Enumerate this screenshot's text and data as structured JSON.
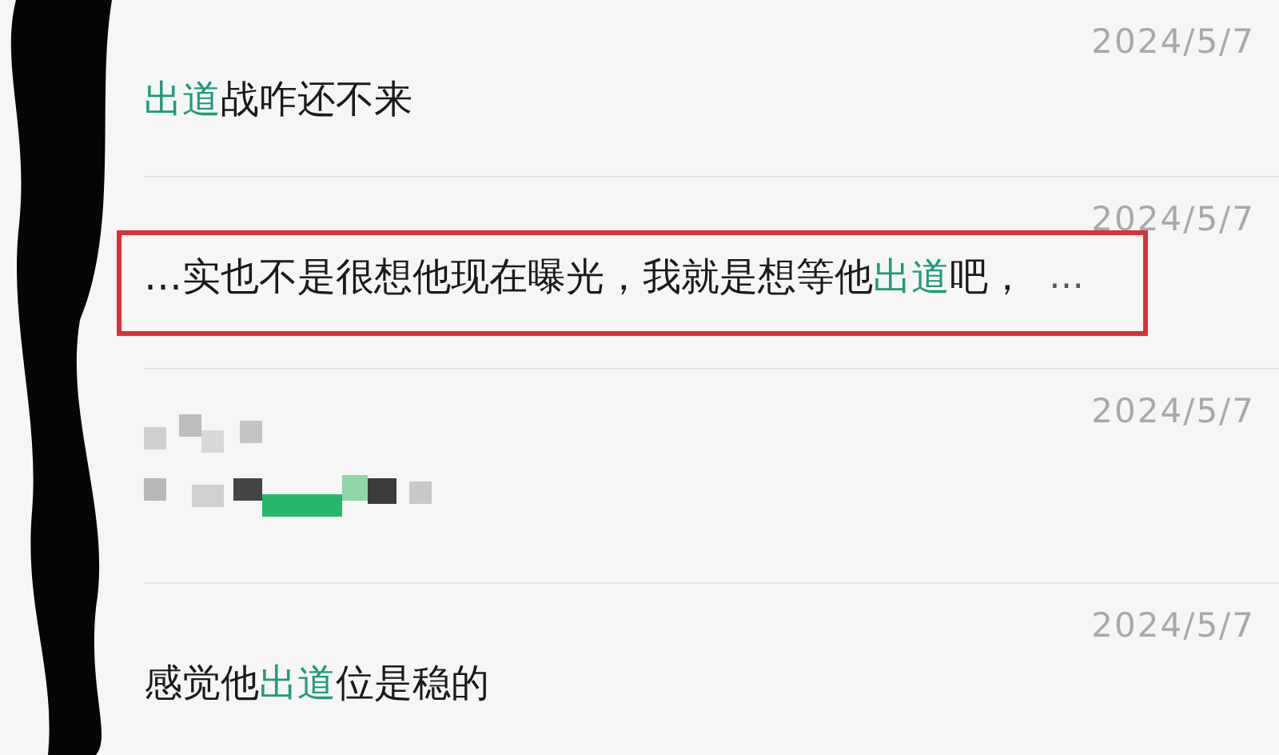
{
  "results": [
    {
      "kind": "text",
      "date": "2024/5/7",
      "boxed": false,
      "segments": [
        {
          "text": "出道",
          "highlight": true
        },
        {
          "text": "战咋还不来",
          "highlight": false
        }
      ]
    },
    {
      "kind": "text",
      "date": "2024/5/7",
      "boxed": true,
      "segments": [
        {
          "text": "…实也不是很想他现在曝光，我就是想等他",
          "highlight": false
        },
        {
          "text": "出道",
          "highlight": true
        },
        {
          "text": "吧，",
          "highlight": false
        }
      ],
      "trailing": "…"
    },
    {
      "kind": "mosaic",
      "date": "2024/5/7",
      "boxed": false
    },
    {
      "kind": "text",
      "date": "2024/5/7",
      "boxed": false,
      "segments": [
        {
          "text": "感觉他",
          "highlight": false
        },
        {
          "text": "出道",
          "highlight": true
        },
        {
          "text": "位是稳的",
          "highlight": false
        }
      ]
    }
  ]
}
